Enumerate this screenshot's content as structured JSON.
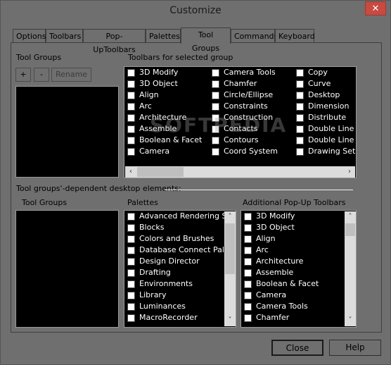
{
  "window": {
    "title": "Customize",
    "close_icon": "close-icon"
  },
  "tabs": [
    {
      "label": "Options"
    },
    {
      "label": "Toolbars"
    },
    {
      "label": "Pop-UpToolbars"
    },
    {
      "label": "Palettes"
    },
    {
      "label": "Tool Groups",
      "active": true
    },
    {
      "label": "Commands"
    },
    {
      "label": "Keyboard"
    }
  ],
  "tool_groups": {
    "heading": "Tool Groups",
    "add_label": "+",
    "remove_label": "-",
    "rename_label": "Rename"
  },
  "toolbars_for_group": {
    "heading": "Toolbars for selected group",
    "columns": [
      [
        "3D Modify",
        "3D Object",
        "Align",
        "Arc",
        "Architecture",
        "Assemble",
        "Boolean & Facet",
        "Camera"
      ],
      [
        "Camera Tools",
        "Chamfer",
        "Circle/Ellipse",
        "Constraints",
        "Construction",
        "Contacts",
        "Contours",
        "Coord System"
      ],
      [
        "Copy",
        "Curve",
        "Desktop",
        "Dimension",
        "Distribute",
        "Double Line",
        "Double Line M",
        "Drawing Setup"
      ]
    ]
  },
  "dependent": {
    "heading": "Tool groups'-dependent desktop elements:",
    "tool_groups_label": "Tool Groups",
    "palettes_label": "Palettes",
    "popup_label": "Additional Pop-Up Toolbars",
    "palettes": [
      "Advanced Rendering Styl",
      "Blocks",
      "Colors and Brushes",
      "Database Connect Palett",
      "Design Director",
      "Drafting",
      "Environments",
      "Library",
      "Luminances",
      "MacroRecorder"
    ],
    "popups": [
      "3D Modify",
      "3D Object",
      "Align",
      "Arc",
      "Architecture",
      "Assemble",
      "Boolean & Facet",
      "Camera",
      "Camera Tools",
      "Chamfer"
    ]
  },
  "footer": {
    "close_label": "Close",
    "help_label": "Help"
  },
  "watermark": "SOFTPEDIA"
}
